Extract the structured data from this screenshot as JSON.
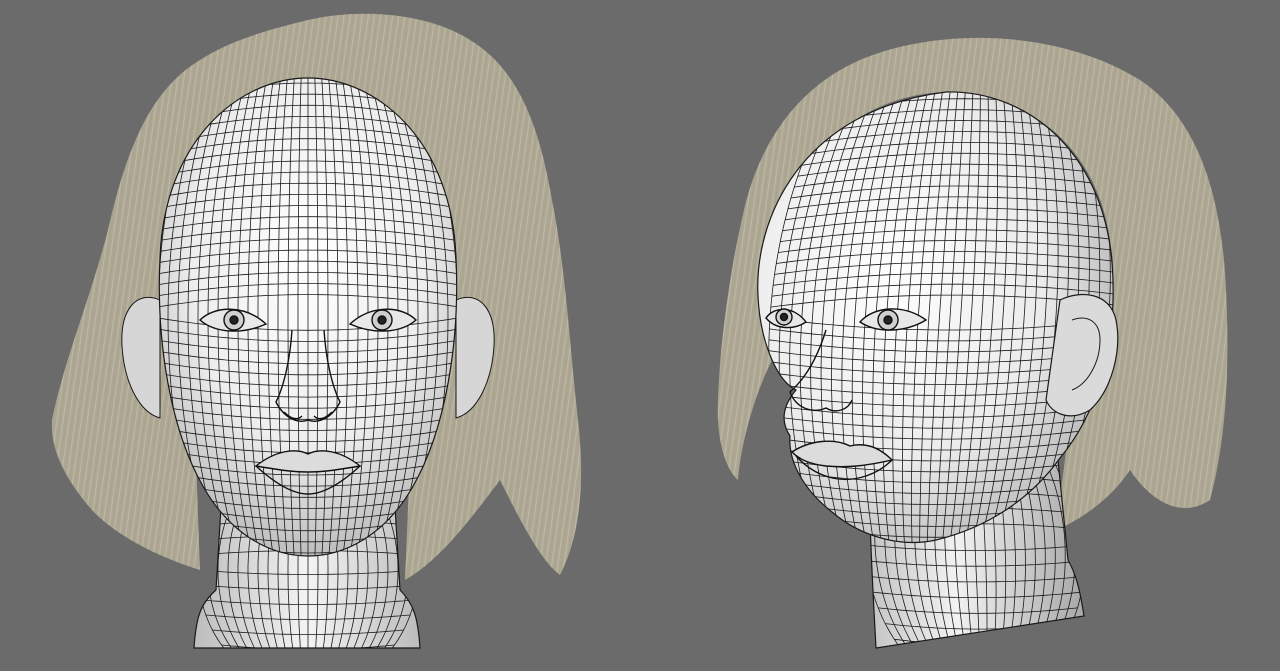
{
  "scene": {
    "background_color": "#6b6b6b",
    "skin_color": "#f2f2f2",
    "skin_shade_color": "#bdbdbd",
    "wire_color": "#1a1a1a",
    "hair_color": "#d3ccb4",
    "hair_dark_color": "#a39b84",
    "views": [
      {
        "name": "front-view",
        "orientation": "front"
      },
      {
        "name": "three-quarter-view",
        "orientation": "three-quarter-left"
      }
    ]
  }
}
